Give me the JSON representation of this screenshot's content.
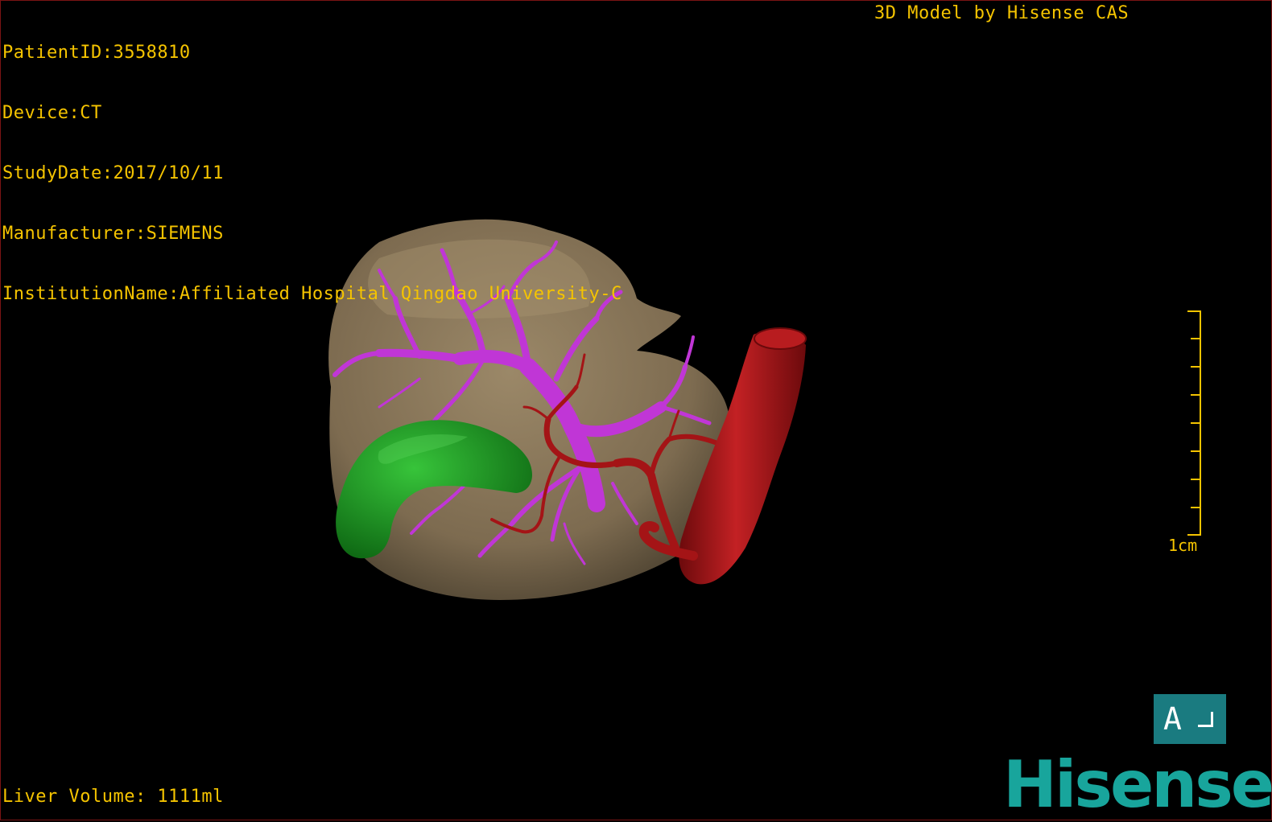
{
  "header": {
    "patient_id": "PatientID:3558810",
    "device": "Device:CT",
    "study_date": "StudyDate:2017/10/11",
    "manufacturer": "Manufacturer:SIEMENS",
    "institution": "InstitutionName:Affiliated Hospital Qingdao University-C",
    "credit": "3D Model by Hisense CAS"
  },
  "footer": {
    "liver_volume": "Liver Volume: 1111ml"
  },
  "scale": {
    "label": "1cm"
  },
  "orientation": {
    "label": "A"
  },
  "brand": {
    "logo_text": "Hisense"
  },
  "colors": {
    "overlay_text": "#f5c400",
    "liver": "#8c7a5c",
    "portal_vein": "#c036d6",
    "artery": "#a41416",
    "gallbladder": "#1f9a26",
    "brand": "#18a59c"
  }
}
